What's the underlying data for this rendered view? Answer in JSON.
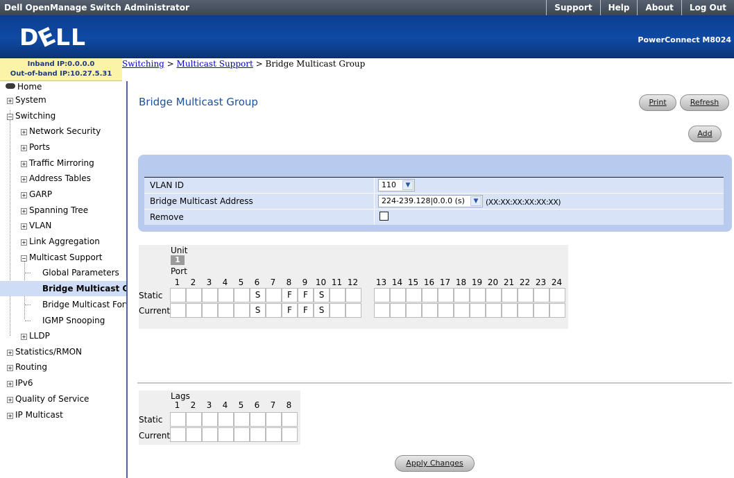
{
  "topbar": {
    "title": "Dell OpenManage Switch Administrator",
    "links": [
      "Support",
      "Help",
      "About",
      "Log Out"
    ]
  },
  "header": {
    "logo": "DELL",
    "product": "PowerConnect M8024"
  },
  "ipinfo": {
    "inband": "Inband IP:0.0.0.0",
    "outband": "Out-of-band IP:10.27.5.31"
  },
  "breadcrumb": {
    "link1": "Switching",
    "sep": " > ",
    "link2": "Multicast Support",
    "current": " > Bridge Multicast Group"
  },
  "sidebar": {
    "items": [
      {
        "label": "Home"
      },
      {
        "label": "System"
      },
      {
        "label": "Switching"
      },
      {
        "label": "Network Security"
      },
      {
        "label": "Ports"
      },
      {
        "label": "Traffic Mirroring"
      },
      {
        "label": "Address Tables"
      },
      {
        "label": "GARP"
      },
      {
        "label": "Spanning Tree"
      },
      {
        "label": "VLAN"
      },
      {
        "label": "Link Aggregation"
      },
      {
        "label": "Multicast Support"
      },
      {
        "label": "Global Parameters"
      },
      {
        "label": "Bridge Multicast Grou"
      },
      {
        "label": "Bridge Multicast Forw"
      },
      {
        "label": "IGMP Snooping"
      },
      {
        "label": "LLDP"
      },
      {
        "label": "Statistics/RMON"
      },
      {
        "label": "Routing"
      },
      {
        "label": "IPv6"
      },
      {
        "label": "Quality of Service"
      },
      {
        "label": "IP Multicast"
      }
    ]
  },
  "main": {
    "title": "Bridge Multicast Group",
    "print_label": "Print",
    "refresh_label": "Refresh",
    "add_label": "Add",
    "apply_label": "Apply Changes"
  },
  "form": {
    "vlan_label": "VLAN ID",
    "vlan_value": "110",
    "bma_label": "Bridge Multicast Address",
    "bma_value": "224-239.128|0.0.0 (s)",
    "bma_hint": "(XX:XX:XX:XX:XX:XX)",
    "remove_label": "Remove",
    "remove_checked": false
  },
  "ports": {
    "unit_label": "Unit",
    "unit_value": "1",
    "port_label": "Port",
    "static_label": "Static",
    "current_label": "Current",
    "numbers": [
      "1",
      "2",
      "3",
      "4",
      "5",
      "6",
      "7",
      "8",
      "9",
      "10",
      "11",
      "12",
      "13",
      "14",
      "15",
      "16",
      "17",
      "18",
      "19",
      "20",
      "21",
      "22",
      "23",
      "24"
    ],
    "static": [
      "",
      "",
      "",
      "",
      "",
      "S",
      "",
      "F",
      "F",
      "S",
      "",
      "",
      "",
      "",
      "",
      "",
      "",
      "",
      "",
      "",
      "",
      "",
      "",
      ""
    ],
    "current": [
      "",
      "",
      "",
      "",
      "",
      "S",
      "",
      "F",
      "F",
      "S",
      "",
      "",
      "",
      "",
      "",
      "",
      "",
      "",
      "",
      "",
      "",
      "",
      "",
      ""
    ]
  },
  "lags": {
    "lags_label": "Lags",
    "static_label": "Static",
    "current_label": "Current",
    "numbers": [
      "1",
      "2",
      "3",
      "4",
      "5",
      "6",
      "7",
      "8"
    ],
    "static": [
      "",
      "",
      "",
      "",
      "",
      "",
      "",
      ""
    ],
    "current": [
      "",
      "",
      "",
      "",
      "",
      "",
      "",
      ""
    ]
  }
}
